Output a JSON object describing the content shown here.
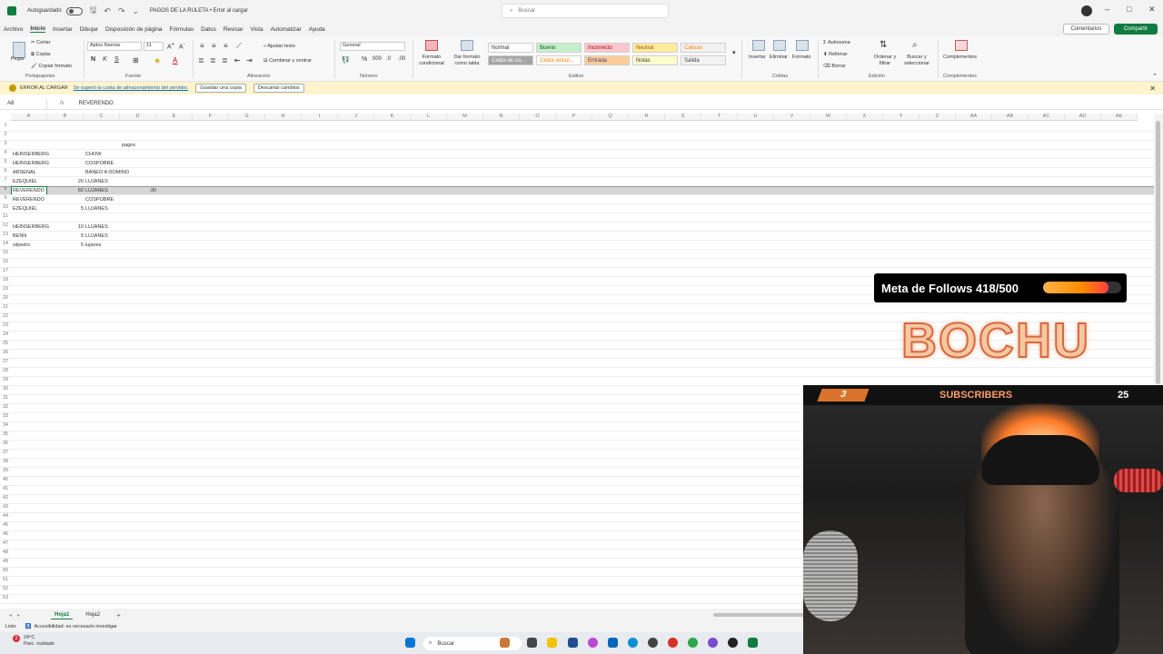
{
  "titlebar": {
    "autosave_label": "Autoguardado",
    "doc_title": "PAGOS DE LA RULETA • Error al cargar",
    "search_placeholder": "Buscar"
  },
  "menu": [
    "Archivo",
    "Inicio",
    "Insertar",
    "Dibujar",
    "Disposición de página",
    "Fórmulas",
    "Datos",
    "Revisar",
    "Vista",
    "Automatizar",
    "Ayuda"
  ],
  "menu_active": "Inicio",
  "menu_actions": {
    "comments": "Comentarios",
    "share": "Compartir"
  },
  "ribbon": {
    "clipboard": {
      "paste": "Pegar",
      "cut": "Cortar",
      "copy": "Copiar",
      "format_painter": "Copiar formato",
      "label": "Portapapeles"
    },
    "font": {
      "name": "Aptos Narrow",
      "size": "11",
      "label": "Fuente"
    },
    "alignment": {
      "wrap": "Ajustar texto",
      "merge": "Combinar y centrar",
      "label": "Alineación"
    },
    "number": {
      "format": "General",
      "label": "Número"
    },
    "styles": {
      "cond_format": "Formato condicional",
      "table_format": "Dar formato como tabla",
      "cells": [
        {
          "label": "Normal",
          "bg": "#ffffff",
          "fg": "#333333"
        },
        {
          "label": "Bueno",
          "bg": "#c6efce",
          "fg": "#006100"
        },
        {
          "label": "Incorrecto",
          "bg": "#ffc7ce",
          "fg": "#9c0006"
        },
        {
          "label": "Neutral",
          "bg": "#ffeb9c",
          "fg": "#9c5700"
        },
        {
          "label": "Cálculo",
          "bg": "#f2f2f2",
          "fg": "#fa7d00"
        },
        {
          "label": "Celda de co...",
          "bg": "#a5a5a5",
          "fg": "#ffffff"
        },
        {
          "label": "Celda vincul...",
          "bg": "#ffffff",
          "fg": "#fa7d00"
        },
        {
          "label": "Entrada",
          "bg": "#ffcc99",
          "fg": "#3f3f76"
        },
        {
          "label": "Notas",
          "bg": "#ffffcc",
          "fg": "#333333"
        },
        {
          "label": "Salida",
          "bg": "#f2f2f2",
          "fg": "#3f3f3f"
        }
      ],
      "label": "Estilos"
    },
    "cells": {
      "insert": "Insertar",
      "delete": "Eliminar",
      "format": "Formato",
      "label": "Celdas"
    },
    "editing": {
      "autosum": "Autosuma",
      "fill": "Rellenar",
      "clear": "Borrar",
      "sort": "Ordenar y filtrar",
      "find": "Buscar y seleccionar",
      "label": "Edición"
    },
    "addins": {
      "addins": "Complementos",
      "label": "Complementos"
    }
  },
  "msgbar": {
    "title": "ERROR AL CARGAR",
    "link": "Se superó la cuota de almacenamiento del servidor.",
    "save_copy": "Guardar una copia",
    "discard": "Descartar cambios"
  },
  "formula": {
    "namebox": "A8",
    "fx": "fx",
    "value": "REVERENDO"
  },
  "columns": [
    "A",
    "B",
    "C",
    "D",
    "E",
    "F",
    "G",
    "H",
    "I",
    "J",
    "K",
    "L",
    "M",
    "N",
    "O",
    "P",
    "Q",
    "R",
    "S",
    "T",
    "U",
    "V",
    "W",
    "X",
    "Y",
    "Z",
    "AA",
    "AB",
    "AC",
    "AD",
    "AE"
  ],
  "rows": [
    {
      "n": "1"
    },
    {
      "n": "2"
    },
    {
      "n": "3",
      "d": "pagos"
    },
    {
      "n": "4",
      "a": "HEINSERBERG",
      "c": "CHOW"
    },
    {
      "n": "5",
      "a": "HEINSERBERG",
      "c": "COSPOBRE"
    },
    {
      "n": "6",
      "a": "ARSENAL",
      "c": "BANEO A DOMINO"
    },
    {
      "n": "7",
      "a": "EZEQUIEL",
      "b": "20",
      "c": "LUJANES"
    },
    {
      "n": "8",
      "a": "REVERENDO",
      "b": "60",
      "c": "LUJANES",
      "d": "-30"
    },
    {
      "n": "9",
      "a": "REVERENDO",
      "c": "COSPOBRE"
    },
    {
      "n": "10",
      "a": "EZEQUIEL",
      "b": "5",
      "c": "LUJANES"
    },
    {
      "n": "11"
    },
    {
      "n": "12",
      "a": "HEINSERBERG",
      "b": "10",
      "c": "LUJANES"
    },
    {
      "n": "13",
      "a": "BENN",
      "b": "5",
      "c": "LUJANES"
    },
    {
      "n": "14",
      "a": "silpedro",
      "b": "5",
      "c": "lujanes"
    }
  ],
  "empty_rows_start": 15,
  "empty_rows_end": 53,
  "sheets": [
    "Hoja1",
    "Hoja2"
  ],
  "active_sheet": "Hoja1",
  "status": {
    "ready": "Listo",
    "accessibility": "Accesibilidad: es necesario investigar"
  },
  "taskbar": {
    "temp": "24°C",
    "weather": "Parc. nublado",
    "search": "Buscar",
    "badge": "2"
  },
  "overlay": {
    "follows_label": "Meta de Follows 418/500",
    "follows_current": 418,
    "follows_goal": 500,
    "brand": "BOCHU",
    "sub_count": "3",
    "sub_label": "SUBSCRIBERS",
    "sub_goal": "25"
  },
  "colors": {
    "excel_green": "#107c41",
    "accent_orange": "#ff8a00"
  }
}
